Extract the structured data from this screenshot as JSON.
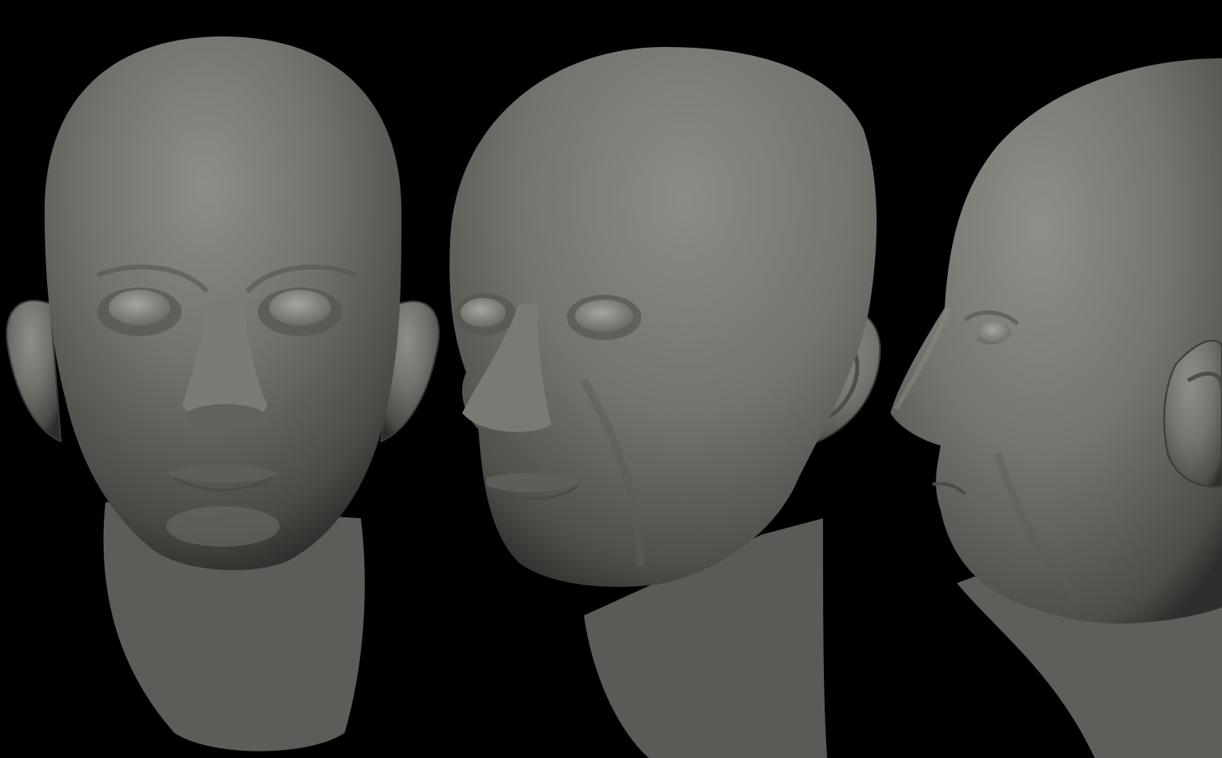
{
  "scene": {
    "background_color": "#000000",
    "clay_color": "#6f6f6a",
    "clay_highlight_color": "#8c8c86",
    "clay_shadow_color": "#3a3a37",
    "views": [
      {
        "name": "front-view",
        "description_icon": "head-front-icon"
      },
      {
        "name": "three-quarter-view",
        "description_icon": "head-three-quarter-icon"
      },
      {
        "name": "side-view",
        "description_icon": "head-side-icon"
      }
    ]
  }
}
